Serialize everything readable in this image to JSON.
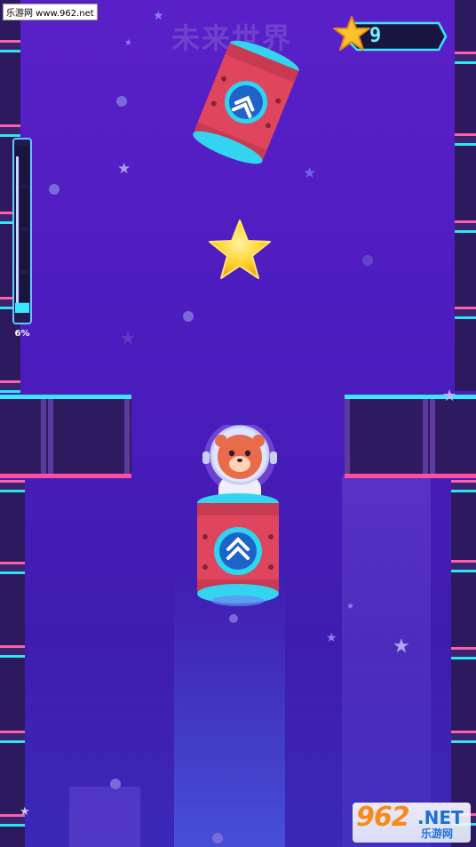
{
  "watermark": {
    "top_left": "乐游网 www.962.net"
  },
  "header": {
    "title": "未来世界"
  },
  "score": {
    "icon": "star-icon",
    "value": "9"
  },
  "progress": {
    "percent_label": "6%",
    "fraction": 0.06
  },
  "logo": {
    "number": "962",
    "suffix": ".NET",
    "name": "乐游网"
  },
  "colors": {
    "background": "#4a1cbc",
    "neon_cyan": "#39e8ff",
    "neon_pink": "#ff4fa3",
    "star_gold": "#ffd22e",
    "barrel_red": "#e0455e"
  }
}
